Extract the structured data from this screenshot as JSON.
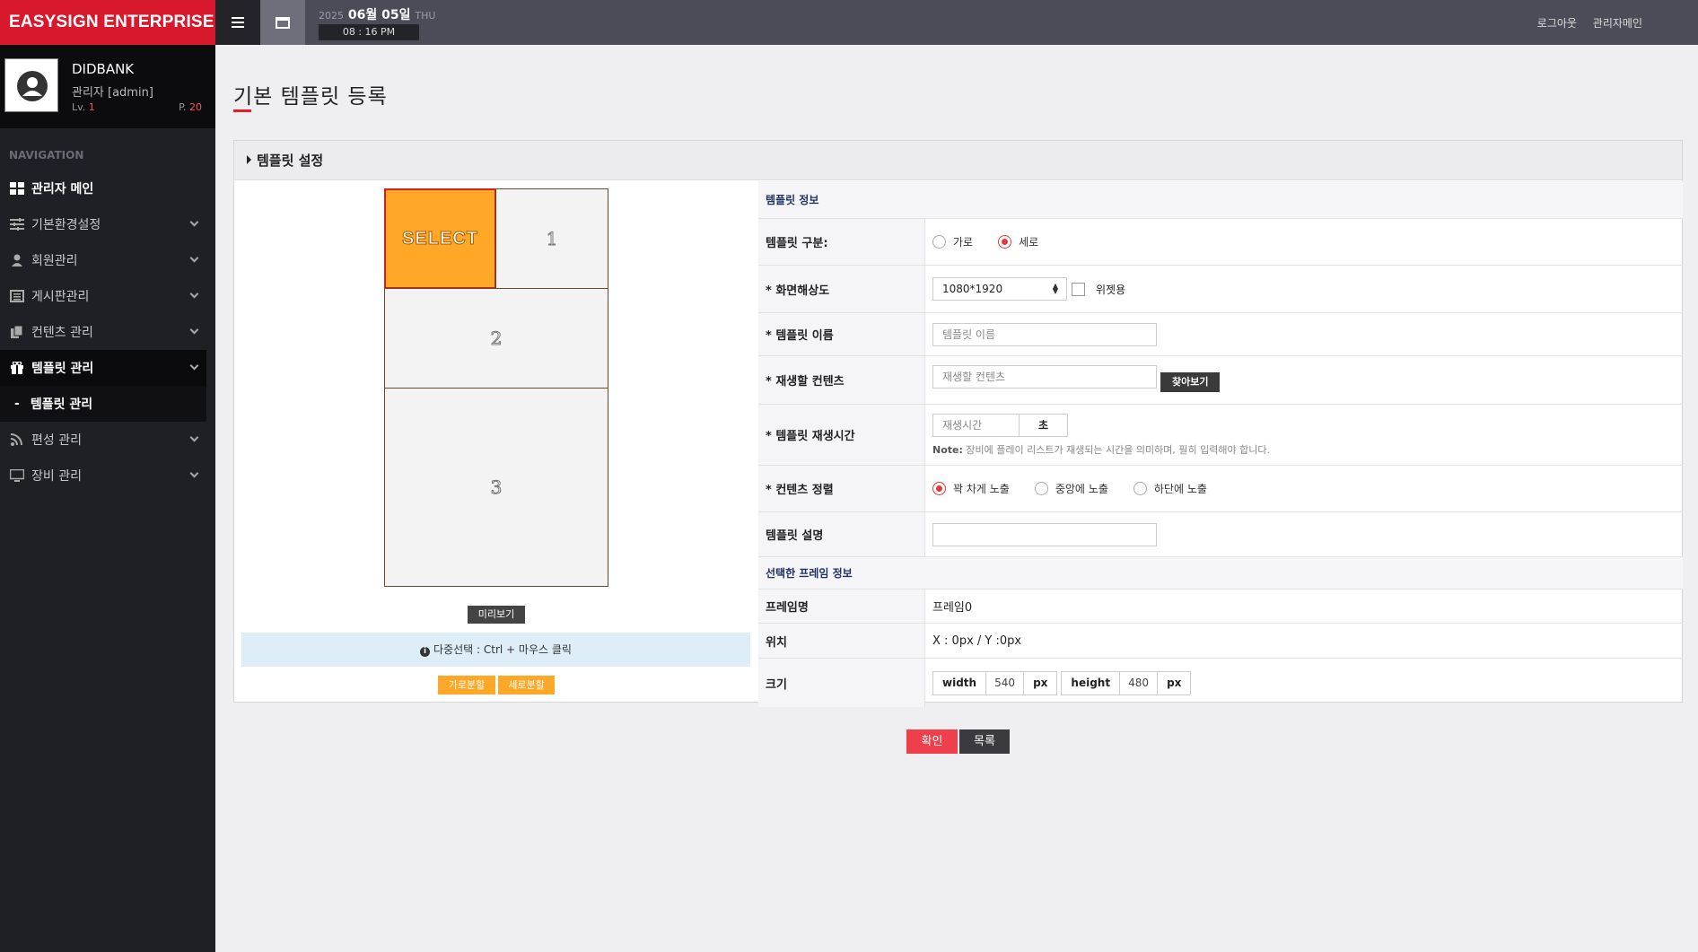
{
  "brand": "EASYSIGN ENTERPRISE",
  "profile": {
    "name": "DIDBANK",
    "role": "관리자 [admin]",
    "level_label": "Lv.",
    "level": "1",
    "points_label": "P.",
    "points": "20"
  },
  "nav": {
    "title": "NAVIGATION",
    "items": [
      {
        "label": "관리자 메인",
        "icon": "grid-icon"
      },
      {
        "label": "기본환경설정",
        "icon": "sliders-icon"
      },
      {
        "label": "회원관리",
        "icon": "user-icon"
      },
      {
        "label": "게시판관리",
        "icon": "board-icon"
      },
      {
        "label": "컨텐츠 관리",
        "icon": "copy-icon"
      },
      {
        "label": "템플릿 관리",
        "icon": "gift-icon"
      },
      {
        "label": "편성 관리",
        "icon": "rss-icon"
      },
      {
        "label": "장비 관리",
        "icon": "monitor-icon"
      }
    ],
    "sub_item": "템플릿 관리"
  },
  "topbar": {
    "year": "2025",
    "date": "06월 05일",
    "weekday": "THU",
    "time": "08 : 16 PM",
    "logout": "로그아웃",
    "admin_main": "관리자메인"
  },
  "page": {
    "title": "기본 템플릿 등록",
    "panel_title": "템플릿 설정"
  },
  "template": {
    "frames": [
      "SELECT",
      "1",
      "2",
      "3"
    ],
    "preview_btn": "미리보기",
    "info": "다중선택 : Ctrl + 마우스 클릭",
    "hsplit_btn": "가로분할",
    "vsplit_btn": "세로분할"
  },
  "form": {
    "section1": "템플릿 정보",
    "type_label": "템플릿 구분:",
    "type_options": [
      "가로",
      "세로"
    ],
    "type_selected": "세로",
    "resolution_label": "* 화면해상도",
    "resolution_value": "1080*1920",
    "widget_label": "위젯용",
    "name_label": "* 템플릿 이름",
    "name_placeholder": "템플릿 이름",
    "content_label": "* 재생할 컨텐츠",
    "content_placeholder": "재생할 컨텐츠",
    "find_btn": "찾아보기",
    "playtime_label": "* 템플릿 재생시간",
    "playtime_placeholder": "재생시간",
    "playtime_unit": "초",
    "note_label": "Note:",
    "note_text": "장비에 플레이 리스트가 재생되는 시간을 의미하며, 필히 입력해야 합니다.",
    "align_label": "* 컨텐츠 정렬",
    "align_options": [
      "꽉 차게 노출",
      "중앙에 노출",
      "하단에 노출"
    ],
    "align_selected": "꽉 차게 노출",
    "desc_label": "템플릿 설명",
    "section2": "선택한 프레임 정보",
    "frame_name_label": "프레임명",
    "frame_name": "프레임0",
    "position_label": "위치",
    "position_value": "X : 0px / Y :0px",
    "size_label": "크기",
    "width_label": "width",
    "width_value": "540",
    "height_label": "height",
    "height_value": "480",
    "unit": "px"
  },
  "buttons": {
    "confirm": "확인",
    "list": "목록"
  },
  "colors": {
    "brand": "#d8182c",
    "select_frame": "#ffa726",
    "accent": "#e03a3a"
  }
}
